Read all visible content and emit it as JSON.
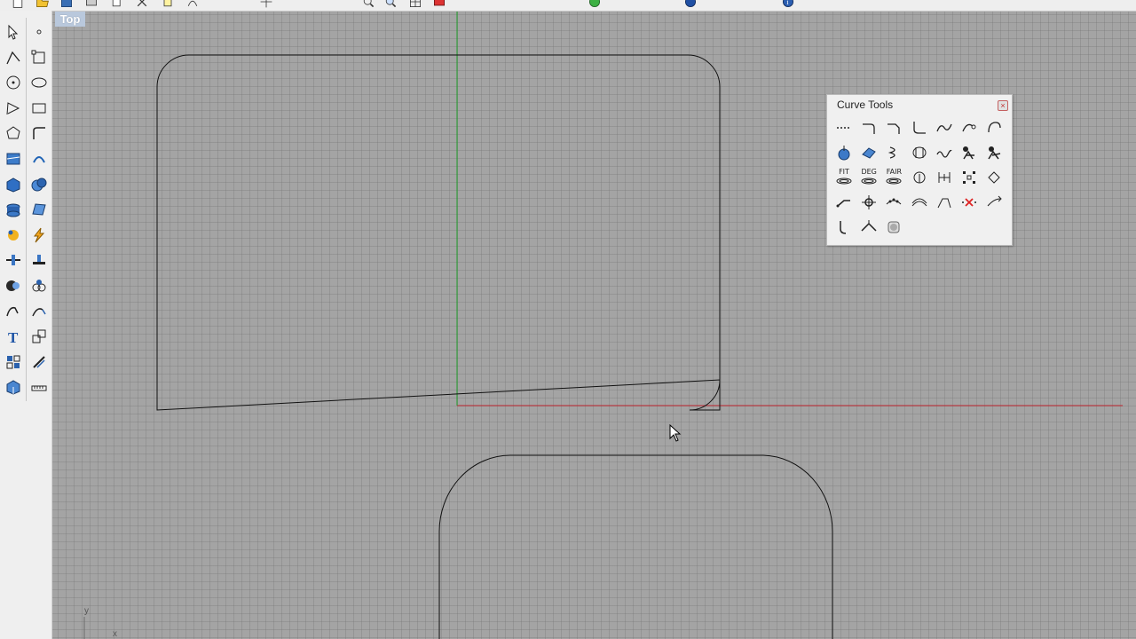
{
  "viewport": {
    "title": "Top",
    "axis_labels": {
      "y": "y",
      "x": "x"
    }
  },
  "curve_tools": {
    "title": "Curve Tools",
    "close_glyph": "×",
    "buttons": [
      {
        "name": "polyline-dashed-icon"
      },
      {
        "name": "fillet-curves-icon"
      },
      {
        "name": "chamfer-curves-icon"
      },
      {
        "name": "blend-curves-icon"
      },
      {
        "name": "match-curves-icon"
      },
      {
        "name": "adjustable-blend-icon"
      },
      {
        "name": "arc-blend-icon"
      },
      {
        "name": "control-points-icon"
      },
      {
        "name": "edit-points-icon"
      },
      {
        "name": "helix-icon"
      },
      {
        "name": "spiral-icon"
      },
      {
        "name": "sine-curve-icon"
      },
      {
        "name": "conic-icon"
      },
      {
        "name": "arc-extend-icon"
      },
      {
        "label": "FIT",
        "name": "fit-curve-icon"
      },
      {
        "label": "DEG",
        "name": "change-degree-icon"
      },
      {
        "label": "FAIR",
        "name": "fair-curve-icon"
      },
      {
        "name": "rebuild-icon"
      },
      {
        "name": "refit-icon"
      },
      {
        "name": "insert-knot-icon"
      },
      {
        "name": "simplify-icon"
      },
      {
        "name": "extend-curve-icon"
      },
      {
        "name": "add-kink-icon"
      },
      {
        "name": "insert-point-icon"
      },
      {
        "name": "offset-curve-icon"
      },
      {
        "name": "adjust-seam-icon"
      },
      {
        "name": "remove-knot-icon"
      },
      {
        "name": "crv-end-icon"
      },
      {
        "name": "curve-from-2-views-icon"
      },
      {
        "name": "curve-on-surface-icon"
      },
      {
        "name": "convert-icon"
      }
    ]
  },
  "left_toolbar": {
    "buttons": [
      "select-arrow-icon",
      "point-icon",
      "polyline-icon",
      "curve-icon",
      "circle-icon",
      "ellipse-icon",
      "arc-icon",
      "rectangle-icon",
      "polygon-icon",
      "fillet-icon",
      "free-form-icon",
      "offset-icon",
      "box-icon",
      "sphere-icon",
      "cylinder-icon",
      "surface-icon",
      "explode-icon",
      "lightning-icon",
      "split-icon",
      "trim-icon",
      "boolean-icon",
      "join-icon",
      "curve-tools-icon",
      "extend-icon",
      "text-icon",
      "scale-icon",
      "grid-icon",
      "dimension-icon",
      "layer-icon",
      "ruler-icon"
    ]
  },
  "top_toolbar": {
    "buttons": [
      "new-icon",
      "open-icon",
      "save-icon",
      "print-icon",
      "copy-icon",
      "cut-icon",
      "paste-icon",
      "undo-icon",
      "pan-icon",
      "zoom-icon",
      "zoom-extents-icon",
      "zoom-window-icon",
      "viewport-icon",
      "shade-icon",
      "render-icon",
      "help-icon"
    ]
  }
}
